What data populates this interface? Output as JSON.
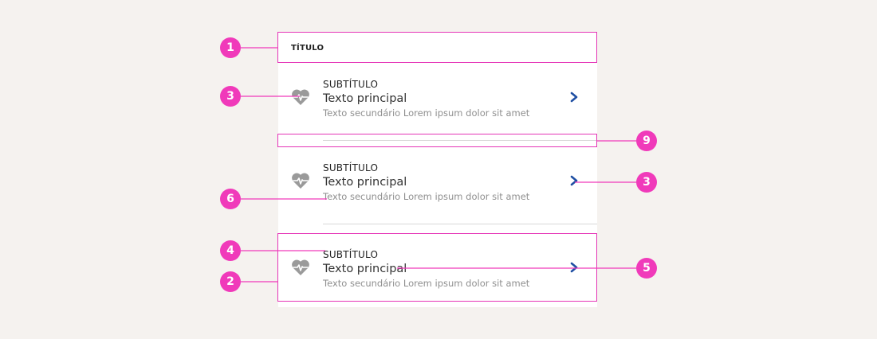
{
  "list": {
    "title": "TÍTULO",
    "items": [
      {
        "subtitle": "SUBTÍTULO",
        "main": "Texto principal",
        "secondary": "Texto secundário Lorem ipsum dolor sit amet",
        "icon": "heart-pulse-icon",
        "trailing_icon": "chevron-right-icon"
      },
      {
        "subtitle": "SUBTÍTULO",
        "main": "Texto principal",
        "secondary": "Texto secundário Lorem ipsum dolor sit amet",
        "icon": "heart-pulse-icon",
        "trailing_icon": "chevron-right-icon"
      },
      {
        "subtitle": "SUBTÍTULO",
        "main": "Texto principal",
        "secondary": "Texto secundário Lorem ipsum dolor sit amet",
        "icon": "heart-pulse-icon",
        "trailing_icon": "chevron-right-icon"
      }
    ]
  },
  "annotations": [
    "1",
    "3",
    "9",
    "3",
    "6",
    "4",
    "5",
    "2"
  ],
  "colors": {
    "background": "#f5f2ef",
    "surface": "#ffffff",
    "annotation": "#f03aba",
    "chevron": "#1f4fa3",
    "icon": "#9a9a9a",
    "divider": "#d9d9d9"
  }
}
